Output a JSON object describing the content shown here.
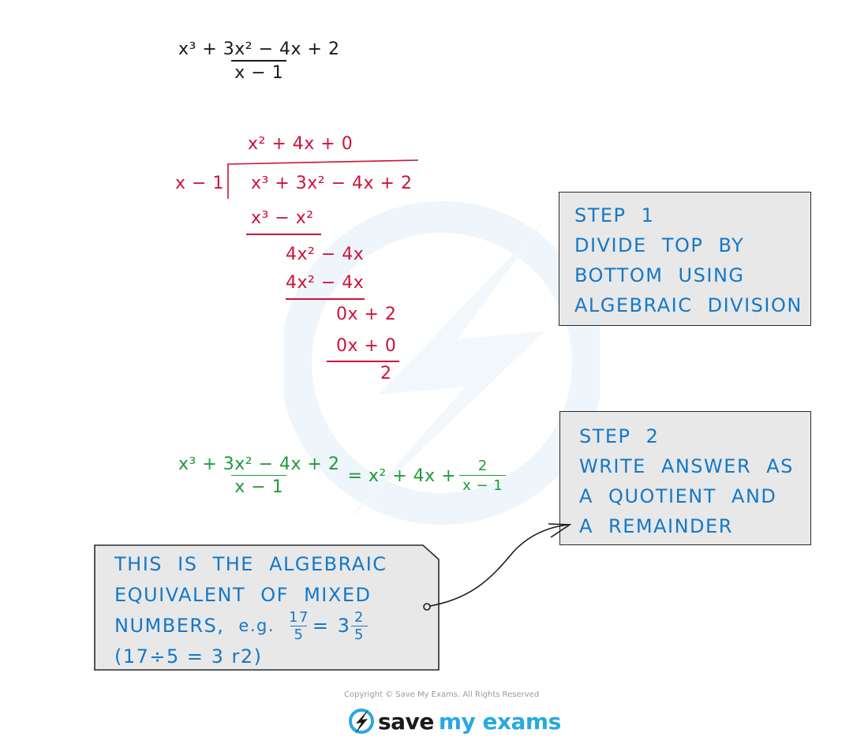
{
  "problem": {
    "numerator": "x³ + 3x² − 4x + 2",
    "denominator": "x − 1"
  },
  "long_division": {
    "quotient": "x² + 4x + 0",
    "divisor": "x − 1",
    "dividend": "x³ + 3x² − 4x + 2",
    "steps": [
      {
        "subtract": "x³ − x²",
        "remainder": "4x² − 4x"
      },
      {
        "subtract": "4x² − 4x",
        "remainder": "0x + 2"
      },
      {
        "subtract": "0x + 0",
        "remainder": "2"
      }
    ],
    "colors": {
      "working": "#d0113b"
    }
  },
  "result": {
    "numerator": "x³ + 3x² − 4x + 2",
    "denominator": "x − 1",
    "equals": "= x² + 4x +",
    "remainder_numerator": "2",
    "remainder_denominator": "x − 1",
    "color": "#1f9a3a"
  },
  "step1": {
    "lines": [
      "STEP 1",
      "DIVIDE TOP BY",
      "BOTTOM USING",
      "ALGEBRAIC DIVISION"
    ]
  },
  "step2": {
    "lines": [
      "STEP 2",
      "WRITE ANSWER AS",
      "A QUOTIENT AND",
      "A REMAINDER"
    ]
  },
  "note": {
    "line1": "THIS IS THE ALGEBRAIC",
    "line2": "EQUIVALENT OF MIXED",
    "line3_text": "NUMBERS,",
    "line3_eg": "e.g.",
    "frac1_num": "17",
    "frac1_den": "5",
    "equals": "= 3",
    "frac2_num": "2",
    "frac2_den": "5",
    "line4": "(17÷5 = 3 r2)"
  },
  "footer": {
    "copyright": "Copyright © Save My Exams. All Rights Reserved",
    "logo_part1": "save",
    "logo_part2": "my exams",
    "brand_color": "#29a8e0"
  }
}
